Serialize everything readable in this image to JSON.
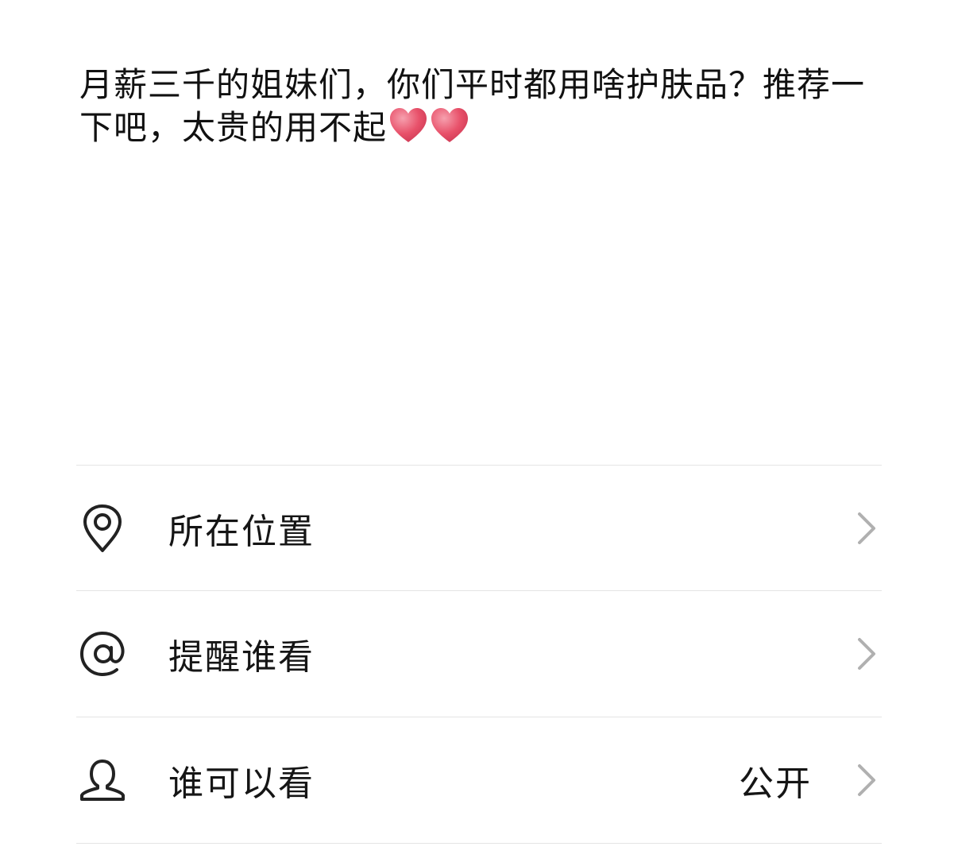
{
  "post": {
    "text": "月薪三千的姐妹们，你们平时都用啥护肤品？推荐一下吧，太贵的用不起",
    "emoji": [
      "heart-emoji",
      "heart-emoji"
    ]
  },
  "options": [
    {
      "icon": "location-pin-icon",
      "label": "所在位置",
      "value": ""
    },
    {
      "icon": "at-sign-icon",
      "label": "提醒谁看",
      "value": ""
    },
    {
      "icon": "person-icon",
      "label": "谁可以看",
      "value": "公开"
    }
  ],
  "colors": {
    "heart": "#e8516a",
    "divider": "#e4e4e4",
    "chevron": "#b0b0b0",
    "text": "#111111"
  }
}
